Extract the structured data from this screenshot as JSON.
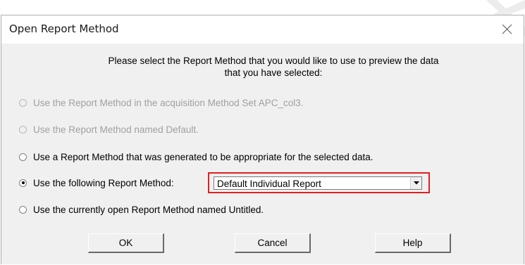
{
  "dialog": {
    "title": "Open Report Method",
    "close_icon": "close-icon",
    "prompt_line1": "Please select the Report Method that you would like to use to preview the data",
    "prompt_line2": "that you have selected:",
    "options": [
      {
        "label": "Use the Report Method in the acquisition Method Set APC_col3.",
        "enabled": false,
        "selected": false
      },
      {
        "label": "Use the Report Method named Default.",
        "enabled": false,
        "selected": false
      },
      {
        "label": "Use a Report Method that was generated to be appropriate for the selected data.",
        "enabled": true,
        "selected": false
      },
      {
        "label": "Use the following Report Method:",
        "enabled": true,
        "selected": true
      },
      {
        "label": "Use the currently open Report Method named Untitled.",
        "enabled": true,
        "selected": false
      }
    ],
    "report_method_select": {
      "value": "Default Individual Report",
      "highlight_color": "#e02020"
    },
    "buttons": {
      "ok": "OK",
      "cancel": "Cancel",
      "help": "Help"
    }
  }
}
